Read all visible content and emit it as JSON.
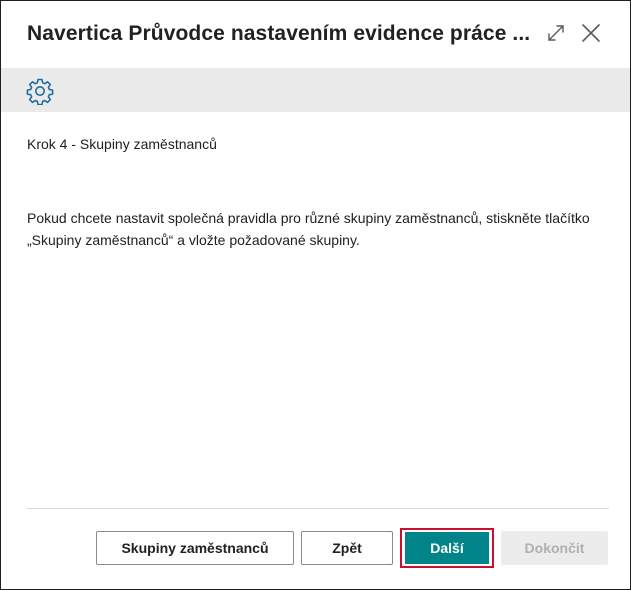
{
  "dialog": {
    "title": "Navertica Průvodce nastavením evidence práce ...",
    "icons": {
      "expand": "expand-icon",
      "close": "close-icon",
      "settings": "gear-icon"
    }
  },
  "content": {
    "step_title": "Krok 4 - Skupiny zaměstnanců",
    "description": "Pokud chcete nastavit společná pravidla pro různé skupiny zaměstnanců, stiskněte tlačítko „Skupiny zaměstnanců“ a vložte požadované skupiny."
  },
  "footer": {
    "groups_label": "Skupiny zaměstnanců",
    "back_label": "Zpět",
    "next_label": "Další",
    "finish_label": "Dokončit"
  },
  "colors": {
    "primary": "#00848a",
    "highlight_border": "#c8102e",
    "toolbar_bg": "#eaeaea",
    "icon_accent": "#1e6f9f"
  }
}
